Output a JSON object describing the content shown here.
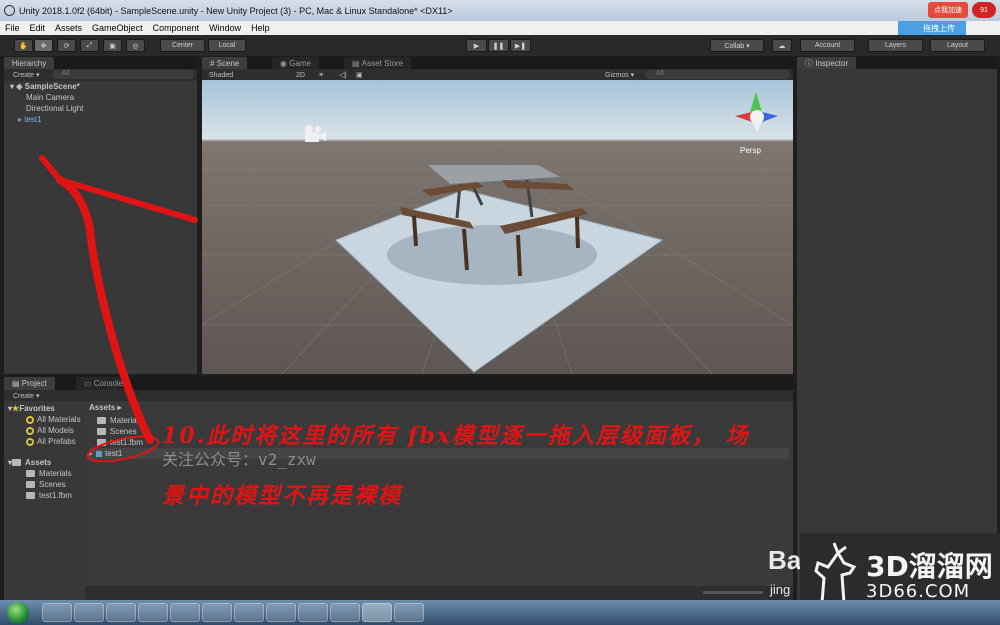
{
  "window": {
    "title": "Unity 2018.1.0f2 (64bit) - SampleScene.unity - New Unity Project (3) - PC, Mac & Linux Standalone* <DX11>",
    "badge_left": "点我加速",
    "badge_right": "91"
  },
  "menu": {
    "items": [
      "File",
      "Edit",
      "Assets",
      "GameObject",
      "Component",
      "Window",
      "Help"
    ],
    "upload_label": "拖拽上传"
  },
  "toolbar": {
    "pivot": "Center",
    "space": "Local",
    "collab": "Collab ▾",
    "account": "Account",
    "layers": "Layers",
    "layout": "Layout"
  },
  "hierarchy": {
    "tab": "Hierarchy",
    "create": "Create ▾",
    "search_placeholder": "All",
    "scene": "SampleScene*",
    "items": [
      "Main Camera",
      "Directional Light",
      "test1"
    ]
  },
  "scene_view": {
    "tabs": [
      "Scene",
      "Game",
      "Asset Store"
    ],
    "shading": "Shaded",
    "mode_2d": "2D",
    "gizmos": "Gizmos ▾",
    "search_placeholder": "All",
    "persp": "Persp"
  },
  "inspector": {
    "tab": "Inspector"
  },
  "project": {
    "tabs": [
      "Project",
      "Console"
    ],
    "create": "Create ▾",
    "favorites_label": "Favorites",
    "favorites": [
      "All Materials",
      "All Models",
      "All Prefabs"
    ],
    "assets_label": "Assets",
    "tree_items": [
      "Materials",
      "Scenes",
      "test1.fbm"
    ],
    "breadcrumb": "Assets ▸",
    "grid_items": [
      "Materials",
      "Scenes",
      "test1.fbm",
      "test1"
    ]
  },
  "annotation": {
    "line1": "10.此时将这里的所有 fbx模型逐一拖入层级面板，  场",
    "line2": "景中的模型不再是裸模",
    "wechat": "关注公众号：v2_zxw"
  },
  "watermarks": {
    "brand_3d": "3D溜溜网",
    "brand_3d_url": "3D66.COM",
    "baidu": "Ba",
    "baidu_sub": "jing"
  },
  "colors": {
    "annotation_red": "#e01414",
    "selected_blue": "#7fb6f0",
    "panel_bg": "#383838"
  }
}
